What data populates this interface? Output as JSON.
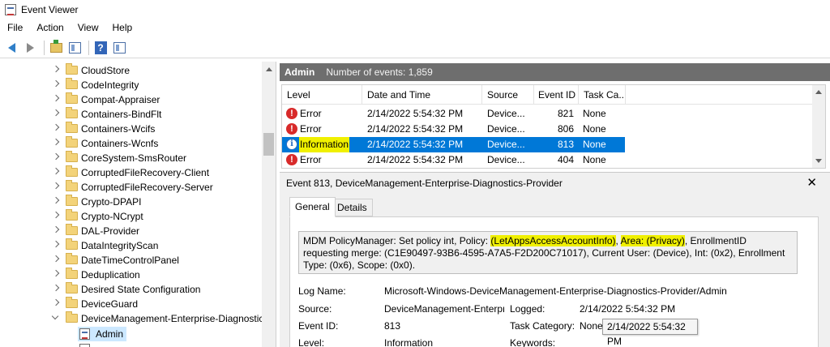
{
  "window": {
    "title": "Event Viewer"
  },
  "menu": [
    "File",
    "Action",
    "View",
    "Help"
  ],
  "toolbar": {
    "buttons": [
      "back-icon",
      "forward-icon",
      "folder-up-icon",
      "show-hide-tree-icon",
      "help-icon",
      "show-hide-action-pane-icon"
    ]
  },
  "tree": {
    "items": [
      "CloudStore",
      "CodeIntegrity",
      "Compat-Appraiser",
      "Containers-BindFlt",
      "Containers-Wcifs",
      "Containers-Wcnfs",
      "CoreSystem-SmsRouter",
      "CorruptedFileRecovery-Client",
      "CorruptedFileRecovery-Server",
      "Crypto-DPAPI",
      "Crypto-NCrypt",
      "DAL-Provider",
      "DataIntegrityScan",
      "DateTimeControlPanel",
      "Deduplication",
      "Desired State Configuration",
      "DeviceGuard",
      "DeviceManagement-Enterprise-Diagnostics"
    ],
    "selected_child": "Admin"
  },
  "panel": {
    "log_name": "Admin",
    "event_count": "Number of events: 1,859"
  },
  "events": {
    "columns": [
      "Level",
      "Date and Time",
      "Source",
      "Event ID",
      "Task Ca..."
    ],
    "rows": [
      {
        "level": "Error",
        "date": "2/14/2022 5:54:32 PM",
        "source": "Device...",
        "event_id": "821",
        "task": "None"
      },
      {
        "level": "Error",
        "date": "2/14/2022 5:54:32 PM",
        "source": "Device...",
        "event_id": "806",
        "task": "None"
      },
      {
        "level": "Information",
        "date": "2/14/2022 5:54:32 PM",
        "source": "Device...",
        "event_id": "813",
        "task": "None"
      },
      {
        "level": "Error",
        "date": "2/14/2022 5:54:32 PM",
        "source": "Device...",
        "event_id": "404",
        "task": "None"
      }
    ]
  },
  "detail": {
    "title": "Event 813, DeviceManagement-Enterprise-Diagnostics-Provider",
    "close": "✕",
    "tabs": [
      "General",
      "Details"
    ],
    "description": {
      "part1": "MDM PolicyManager: Set policy int, Policy: ",
      "highlight1": "(LetAppsAccessAccountInfo)",
      "part2": ", ",
      "highlight2": "Area: (Privacy)",
      "part3": ", EnrollmentID requesting merge: (C1E90497-93B6-4595-A7A5-F2D200C71017), Current User: (Device), Int: (0x2), Enrollment Type: (0x6), Scope: (0x0)."
    },
    "fields": {
      "log_name_label": "Log Name:",
      "log_name_value": "Microsoft-Windows-DeviceManagement-Enterprise-Diagnostics-Provider/Admin",
      "source_label": "Source:",
      "source_value": "DeviceManagement-Enterpr",
      "logged_label": "Logged:",
      "logged_value": "2/14/2022 5:54:32 PM",
      "event_id_label": "Event ID:",
      "event_id_value": "813",
      "task_category_label": "Task Category:",
      "task_category_value": "None",
      "level_label": "Level:",
      "level_value": "Information",
      "keywords_label": "Keywords:"
    },
    "tooltip": "2/14/2022 5:54:32 PM"
  }
}
